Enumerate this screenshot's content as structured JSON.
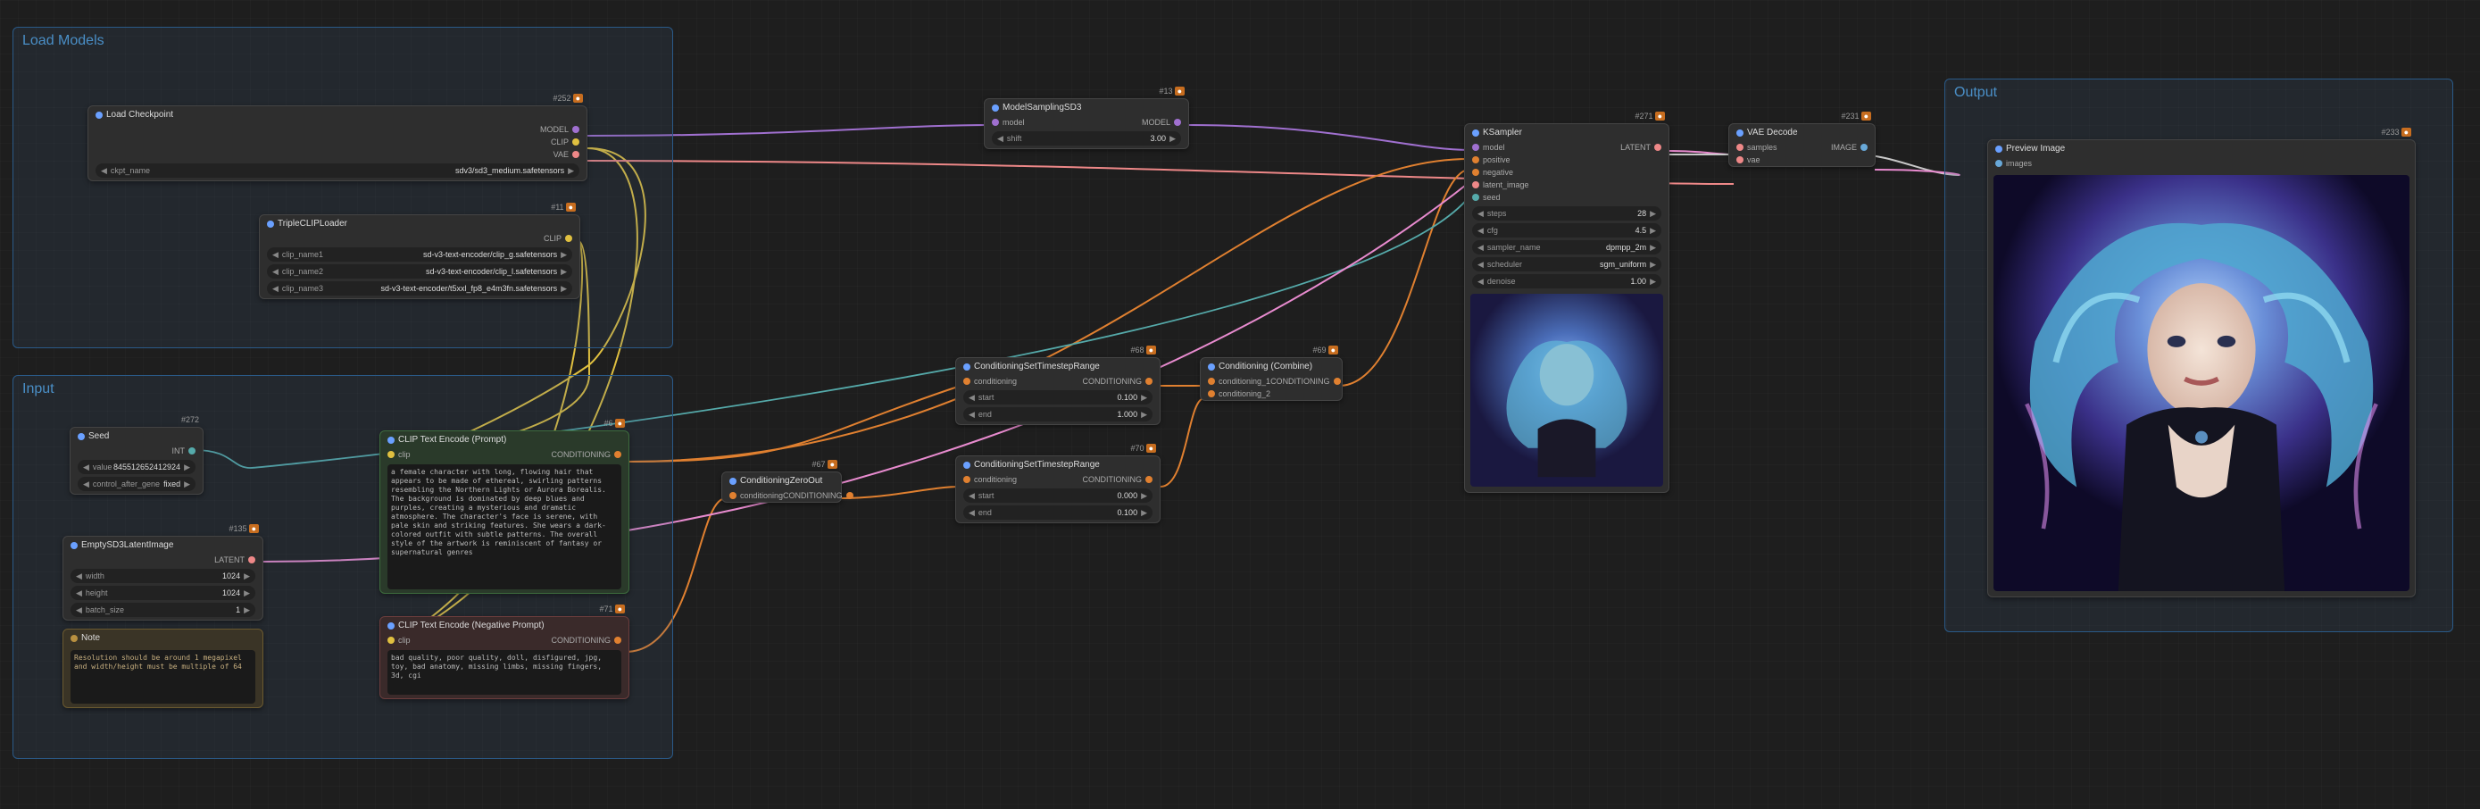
{
  "groups": {
    "loadModels": {
      "title": "Load Models"
    },
    "input": {
      "title": "Input"
    },
    "output": {
      "title": "Output"
    }
  },
  "nodes": {
    "loadCheckpoint": {
      "id": "#252",
      "title": "Load Checkpoint",
      "outputs": [
        "MODEL",
        "CLIP",
        "VAE"
      ],
      "ckpt_label": "ckpt_name",
      "ckpt_value": "sdv3/sd3_medium.safetensors"
    },
    "tripleClip": {
      "id": "#11",
      "title": "TripleCLIPLoader",
      "output": "CLIP",
      "rows": [
        {
          "label": "clip_name1",
          "value": "sd-v3-text-encoder/clip_g.safetensors"
        },
        {
          "label": "clip_name2",
          "value": "sd-v3-text-encoder/clip_l.safetensors"
        },
        {
          "label": "clip_name3",
          "value": "sd-v3-text-encoder/t5xxl_fp8_e4m3fn.safetensors"
        }
      ]
    },
    "seed": {
      "id": "#272",
      "title": "Seed",
      "output": "INT",
      "value_label": "value",
      "value": "845512652412924",
      "cag_label": "control_after_gene",
      "cag_value": "fixed"
    },
    "emptyLatent": {
      "id": "#135",
      "title": "EmptySD3LatentImage",
      "output": "LATENT",
      "width_label": "width",
      "width": "1024",
      "height_label": "height",
      "height": "1024",
      "batch_label": "batch_size",
      "batch": "1"
    },
    "note": {
      "title": "Note",
      "text": "Resolution should be around 1 megapixel and width/height must be multiple of 64"
    },
    "clipPrompt": {
      "id": "#6",
      "title": "CLIP Text Encode (Prompt)",
      "input": "clip",
      "output": "CONDITIONING",
      "text": "a female character with long, flowing hair that appears to be made of ethereal, swirling patterns resembling the Northern Lights or Aurora Borealis. The background is dominated by deep blues and purples, creating a mysterious and dramatic atmosphere. The character's face is serene, with pale skin and striking features. She wears a dark-colored outfit with subtle patterns. The overall style of the artwork is reminiscent of fantasy or supernatural genres"
    },
    "clipNeg": {
      "id": "#71",
      "title": "CLIP Text Encode (Negative Prompt)",
      "input": "clip",
      "output": "CONDITIONING",
      "text": "bad quality, poor quality, doll, disfigured, jpg, toy, bad anatomy, missing limbs, missing fingers, 3d, cgi"
    },
    "condZero": {
      "id": "#67",
      "title": "ConditioningZeroOut",
      "input": "conditioning",
      "output": "CONDITIONING"
    },
    "modelSampling": {
      "id": "#13",
      "title": "ModelSamplingSD3",
      "input": "model",
      "output": "MODEL",
      "shift_label": "shift",
      "shift": "3.00"
    },
    "condSTR1": {
      "id": "#68",
      "title": "ConditioningSetTimestepRange",
      "input": "conditioning",
      "output": "CONDITIONING",
      "start_label": "start",
      "start": "0.100",
      "end_label": "end",
      "end": "1.000"
    },
    "condSTR2": {
      "id": "#70",
      "title": "ConditioningSetTimestepRange",
      "input": "conditioning",
      "output": "CONDITIONING",
      "start_label": "start",
      "start": "0.000",
      "end_label": "end",
      "end": "0.100"
    },
    "condCombine": {
      "id": "#69",
      "title": "Conditioning (Combine)",
      "output": "CONDITIONING",
      "in1": "conditioning_1",
      "in2": "conditioning_2"
    },
    "ksampler": {
      "id": "#271",
      "title": "KSampler",
      "output": "LATENT",
      "inputs": [
        "model",
        "positive",
        "negative",
        "latent_image",
        "seed"
      ],
      "steps_label": "steps",
      "steps": "28",
      "cfg_label": "cfg",
      "cfg": "4.5",
      "sampler_label": "sampler_name",
      "sampler": "dpmpp_2m",
      "scheduler_label": "scheduler",
      "scheduler": "sgm_uniform",
      "denoise_label": "denoise",
      "denoise": "1.00"
    },
    "vaeDecode": {
      "id": "#231",
      "title": "VAE Decode",
      "out": "IMAGE",
      "in1": "samples",
      "in2": "vae"
    },
    "preview": {
      "id": "#233",
      "title": "Preview Image",
      "in": "images"
    }
  }
}
